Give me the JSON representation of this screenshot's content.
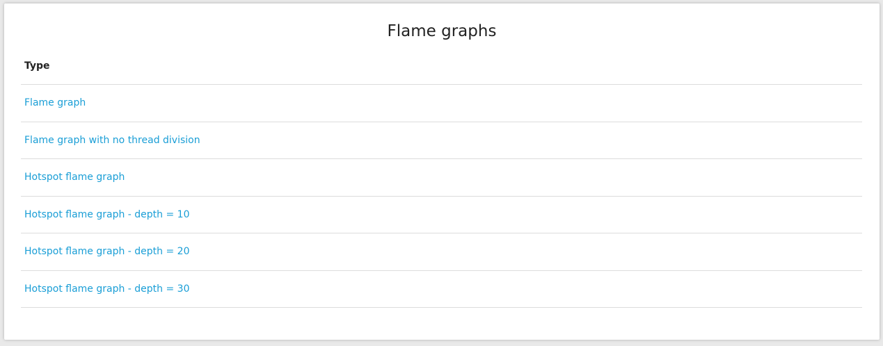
{
  "page": {
    "title": "Flame graphs"
  },
  "table": {
    "header": "Type",
    "rows": [
      {
        "label": "Flame graph"
      },
      {
        "label": "Flame graph with no thread division"
      },
      {
        "label": "Hotspot flame graph"
      },
      {
        "label": "Hotspot flame graph - depth = 10"
      },
      {
        "label": "Hotspot flame graph - depth = 20"
      },
      {
        "label": "Hotspot flame graph - depth = 30"
      }
    ]
  },
  "colors": {
    "link": "#1a9ed6",
    "text": "#222222",
    "divider": "#dcdcdc"
  }
}
